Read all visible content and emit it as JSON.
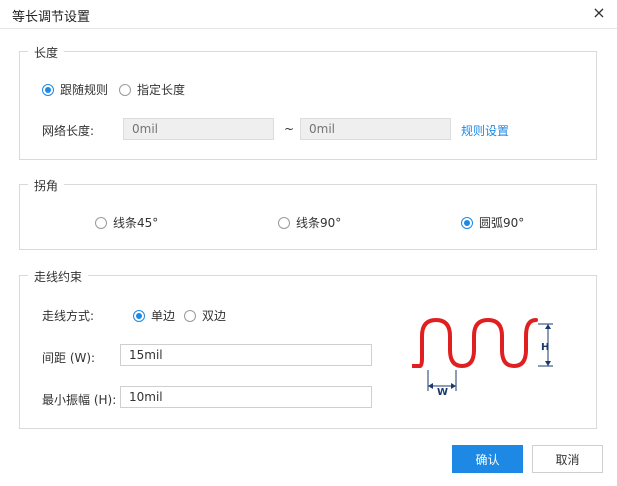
{
  "dialog": {
    "title": "等长调节设置",
    "close_glyph": "×"
  },
  "length": {
    "legend": "长度",
    "options": [
      {
        "label": "跟随规则",
        "checked": true
      },
      {
        "label": "指定长度",
        "checked": false
      }
    ],
    "net_length_label": "网络长度:",
    "from_placeholder": "0mil",
    "to_placeholder": "0mil",
    "tilde": "~",
    "rule_link": "规则设置"
  },
  "corner": {
    "legend": "拐角",
    "options": [
      {
        "label": "线条45°",
        "checked": false
      },
      {
        "label": "线条90°",
        "checked": false
      },
      {
        "label": "圆弧90°",
        "checked": true
      }
    ]
  },
  "routing": {
    "legend": "走线约束",
    "mode_label": "走线方式:",
    "mode_options": [
      {
        "label": "单边",
        "checked": true
      },
      {
        "label": "双边",
        "checked": false
      }
    ],
    "spacing_label": "间距 (W):",
    "spacing_value": "15mil",
    "amplitude_label": "最小振幅 (H):",
    "amplitude_value": "10mil",
    "diagram": {
      "w_label": "W",
      "h_label": "H",
      "trace_color": "#e02020",
      "dim_color": "#1a3a6e"
    }
  },
  "footer": {
    "ok_label": "确认",
    "cancel_label": "取消"
  },
  "colors": {
    "accent": "#1e88e5"
  }
}
